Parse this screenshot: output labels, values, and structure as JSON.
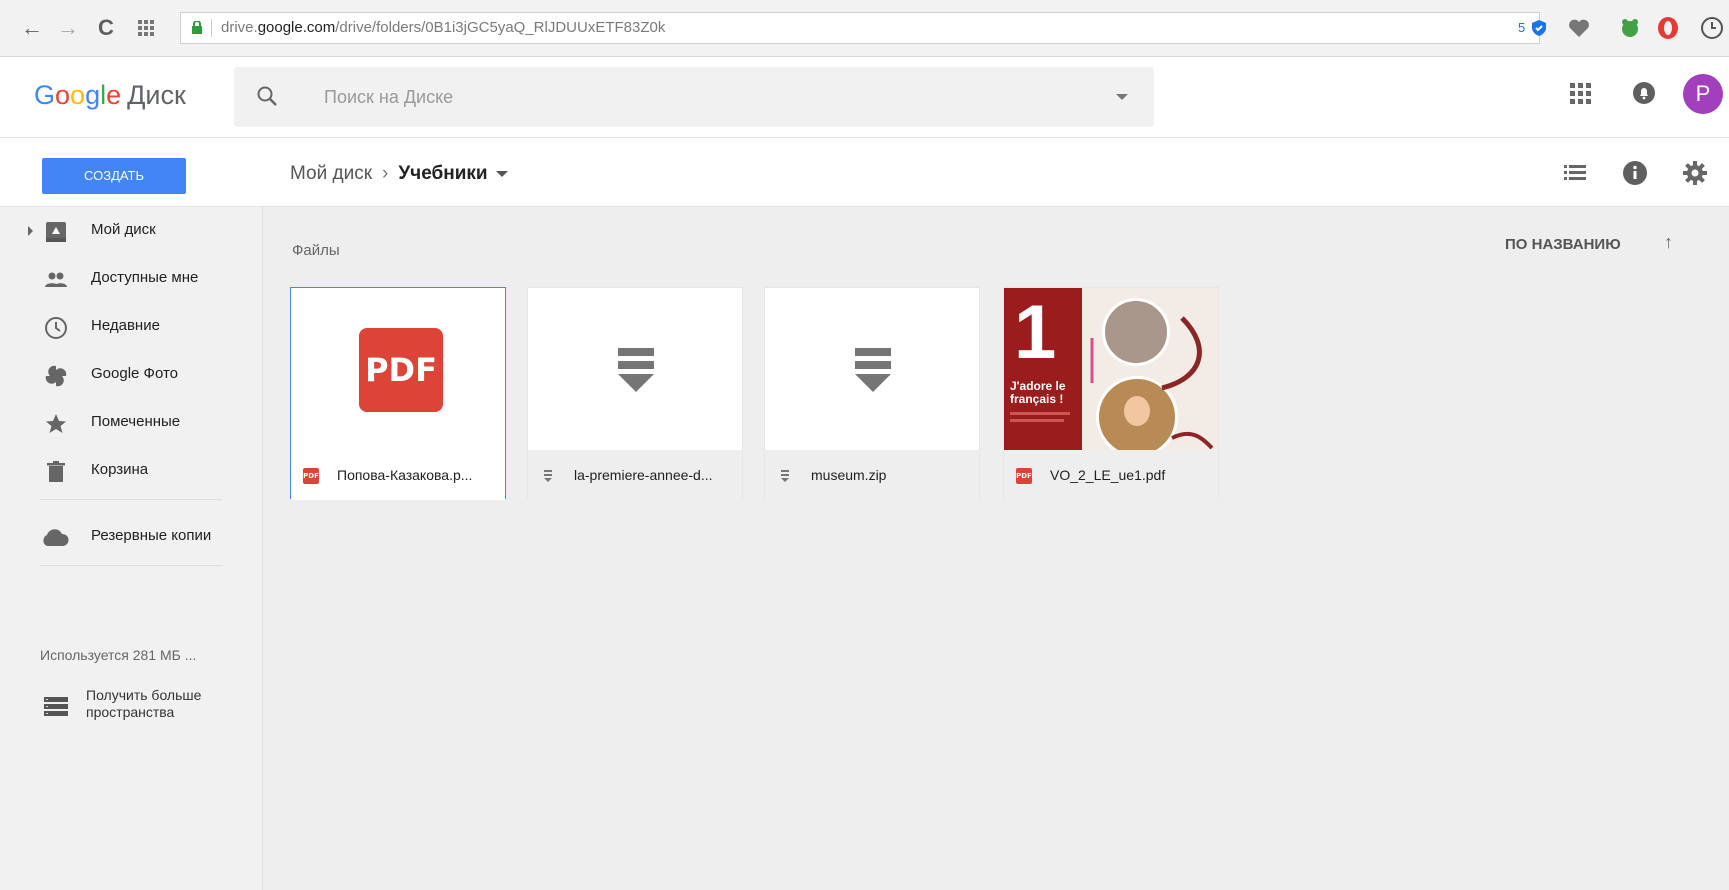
{
  "browser": {
    "url_prefix": "drive.",
    "url_domain": "google.com",
    "url_path": "/drive/folders/0B1i3jGC5yaQ_RlJDUUxETF83Z0k",
    "ext_badge": "5"
  },
  "header": {
    "logo": {
      "g1": "G",
      "g2": "o",
      "g3": "o",
      "g4": "g",
      "g5": "l",
      "g6": "e"
    },
    "product": "Диск",
    "search_placeholder": "Поиск на Диске",
    "avatar_letter": "P"
  },
  "toolbar": {
    "create_label": "СОЗДАТЬ",
    "breadcrumb_root": "Мой диск",
    "breadcrumb_sep": "›",
    "breadcrumb_current": "Учебники"
  },
  "sidebar": {
    "items": [
      {
        "label": "Мой диск",
        "icon": "drive-icon"
      },
      {
        "label": "Доступные мне",
        "icon": "shared-icon"
      },
      {
        "label": "Недавние",
        "icon": "clock-icon"
      },
      {
        "label": "Google Фото",
        "icon": "photos-icon"
      },
      {
        "label": "Помеченные",
        "icon": "star-icon"
      },
      {
        "label": "Корзина",
        "icon": "trash-icon"
      }
    ],
    "backups": "Резервные копии",
    "usage": "Используется 281 МБ ...",
    "more_storage_line1": "Получить больше",
    "more_storage_line2": "пространства"
  },
  "main": {
    "section_label": "Файлы",
    "sort_label": "ПО НАЗВАНИЮ",
    "sort_arrow": "↑",
    "files": [
      {
        "name": "Попова-Казакова.p...",
        "type": "pdf",
        "selected": true
      },
      {
        "name": "la-premiere-annee-d...",
        "type": "zip"
      },
      {
        "name": "museum.zip",
        "type": "zip"
      },
      {
        "name": "VO_2_LE_ue1.pdf",
        "type": "pdf-thumb",
        "thumb_number": "1",
        "thumb_title_1": "J'adore le",
        "thumb_title_2": "français !"
      }
    ],
    "pdf_icon_text": "PDF",
    "pdf_small_text": "PDF"
  },
  "colors": {
    "accent": "#4285f4",
    "pdf_red": "#db4437",
    "avatar": "#a23fbd"
  }
}
